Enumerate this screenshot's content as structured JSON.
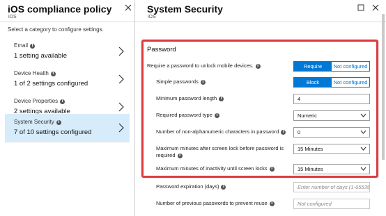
{
  "left_blade": {
    "title": "iOS compliance policy",
    "subtitle": "iOS",
    "hint": "Select a category to configure settings.",
    "categories": [
      {
        "title": "Email",
        "value": "1 setting available"
      },
      {
        "title": "Device Health",
        "value": "1 of 2 settings configured"
      },
      {
        "title": "Device Properties",
        "value": "2 settings available"
      },
      {
        "title": "System Security",
        "value": "7 of 10 settings configured",
        "selected": true
      }
    ]
  },
  "right_blade": {
    "title": "System Security",
    "subtitle": "iOS",
    "section_title": "Password",
    "settings": [
      {
        "label": "Require a password to unlock mobile devices.",
        "type": "toggle",
        "options": [
          "Require",
          "Not configured"
        ],
        "selected": "Require"
      },
      {
        "label": "Simple passwords",
        "type": "toggle",
        "options": [
          "Block",
          "Not configured"
        ],
        "selected": "Block"
      },
      {
        "label": "Minimum password length",
        "type": "text",
        "value": "4"
      },
      {
        "label": "Required password type",
        "type": "dropdown",
        "value": "Numeric"
      },
      {
        "label": "Number of non-alphanumeric characters in password",
        "type": "dropdown",
        "value": "0"
      },
      {
        "label": "Maximum minutes after screen lock before password is",
        "label_line2": "required",
        "type": "dropdown",
        "value": "15 Minutes"
      },
      {
        "label": "Maximum minutes of inactivity until screen locks",
        "type": "dropdown",
        "value": "15 Minutes"
      },
      {
        "label": "Password expiration (days)",
        "type": "text",
        "placeholder": "Enter number of days (1-65535)"
      },
      {
        "label": "Number of previous passwords to prevent reuse",
        "type": "text",
        "placeholder": "Not configured"
      }
    ]
  },
  "icons": [
    "info-icon",
    "chevron-right-icon",
    "close-icon",
    "maximize-icon",
    "chevron-down-icon"
  ],
  "colors": {
    "accent": "#0078d4",
    "selected_bg": "#d6ecfa",
    "highlight_border": "#e03a3e"
  }
}
